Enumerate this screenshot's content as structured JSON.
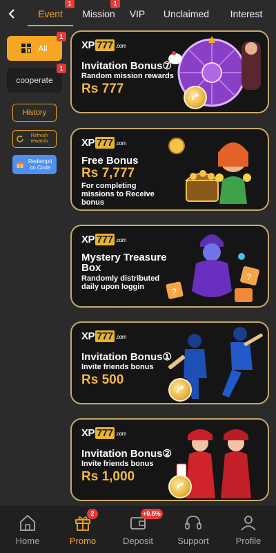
{
  "top_tabs": [
    {
      "label": "Event",
      "badge": "1",
      "active": true
    },
    {
      "label": "Mission",
      "badge": "1"
    },
    {
      "label": "VIP"
    },
    {
      "label": "Unclaimed"
    },
    {
      "label": "Interest"
    }
  ],
  "sidebar": {
    "all_label": "All",
    "all_badge": "1",
    "cooperate_label": "cooperate",
    "cooperate_badge": "1",
    "history_label": "History",
    "refresh_label": "Refresh rewards",
    "redeem_label": "Redempti on Code"
  },
  "cards": [
    {
      "logo_xp": "XP",
      "logo_777": "777",
      "logo_com": ".com",
      "title": "Invitation Bonus⑦",
      "sub": "Random mission rewards",
      "amount": "Rs 777",
      "art": "lucky-wheel"
    },
    {
      "logo_xp": "XP",
      "logo_777": "777",
      "logo_com": ".com",
      "title": "Free Bonus",
      "amount": "Rs 7,777",
      "sub": "For completing missions to Receive bonus",
      "art": "treasure-chest"
    },
    {
      "logo_xp": "XP",
      "logo_777": "777",
      "logo_com": ".com",
      "title": "Mystery Treasure Box",
      "sub": "Randomly distributed daily upon loggin",
      "art": "genie-mystery-boxes"
    },
    {
      "logo_xp": "XP",
      "logo_777": "777",
      "logo_com": ".com",
      "title": "Invitation Bonus①",
      "sub": "Invite friends bonus",
      "amount": "Rs 500",
      "art": "cricket-players"
    },
    {
      "logo_xp": "XP",
      "logo_777": "777",
      "logo_com": ".com",
      "title": "Invitation Bonus②",
      "sub": "Invite friends bonus",
      "amount": "Rs 1,000",
      "art": "red-outfit-women"
    }
  ],
  "bottom_nav": [
    {
      "label": "Home",
      "icon": "home-icon"
    },
    {
      "label": "Promo",
      "icon": "gift-icon",
      "badge": "2",
      "active": true
    },
    {
      "label": "Deposit",
      "icon": "wallet-icon",
      "badge": "+0.5%"
    },
    {
      "label": "Support",
      "icon": "headset-icon"
    },
    {
      "label": "Profile",
      "icon": "user-icon"
    }
  ],
  "colors": {
    "accent": "#f5a623",
    "background": "#2b2b2b",
    "badge": "#e23b3b",
    "card_border": "#c9a96a",
    "amount": "#f5b84a",
    "redeem_bg": "#4f8ff0"
  }
}
